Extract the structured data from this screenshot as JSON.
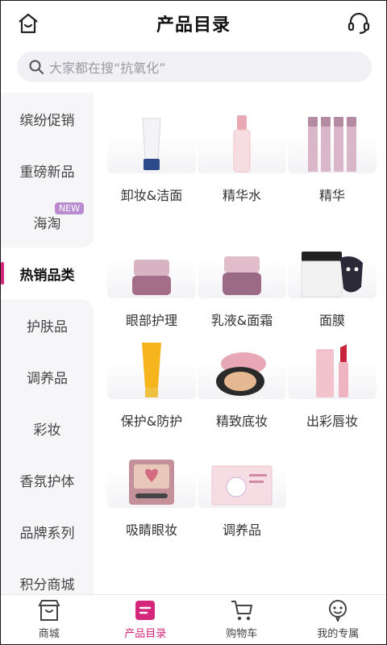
{
  "header": {
    "title": "产品目录"
  },
  "search": {
    "placeholder": "大家都在搜“抗氧化”"
  },
  "sidebar": {
    "items": [
      {
        "label": "缤纷促销"
      },
      {
        "label": "重磅新品"
      },
      {
        "label": "海淘",
        "badge": "NEW"
      },
      {
        "label": "热销品类",
        "active": true
      },
      {
        "label": "护肤品"
      },
      {
        "label": "调养品"
      },
      {
        "label": "彩妆"
      },
      {
        "label": "香氛护体"
      },
      {
        "label": "品牌系列"
      },
      {
        "label": "积分商城"
      }
    ]
  },
  "products": [
    {
      "label": "卸妆&洁面"
    },
    {
      "label": "精华水"
    },
    {
      "label": "精华"
    },
    {
      "label": "眼部护理"
    },
    {
      "label": "乳液&面霜"
    },
    {
      "label": "面膜"
    },
    {
      "label": "保护&防护"
    },
    {
      "label": "精致底妆"
    },
    {
      "label": "出彩唇妆"
    },
    {
      "label": "吸睛眼妆"
    },
    {
      "label": "调养品"
    }
  ],
  "tabbar": {
    "tabs": [
      {
        "label": "商城",
        "icon": "shop-icon"
      },
      {
        "label": "产品目录",
        "icon": "catalog-icon",
        "active": true
      },
      {
        "label": "购物车",
        "icon": "cart-icon"
      },
      {
        "label": "我的专属",
        "icon": "profile-icon"
      }
    ]
  },
  "colors": {
    "accent": "#d4267a",
    "badge": "#b98ccf",
    "search_bg": "#f1f1f5",
    "sidebar_bg": "#f6f6f8"
  }
}
